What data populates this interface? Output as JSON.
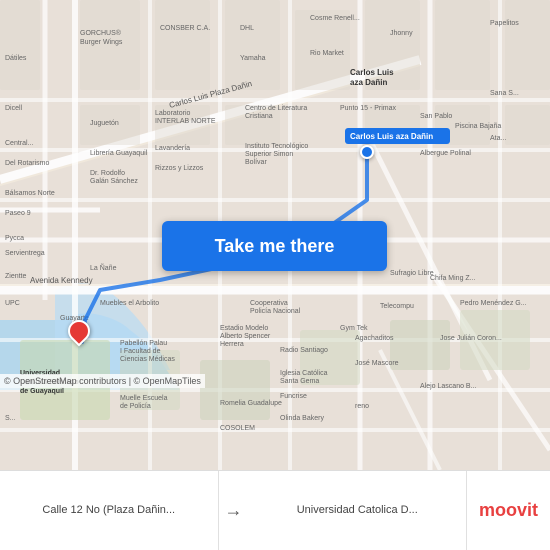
{
  "map": {
    "background_color": "#e8e0d8",
    "attribution": "© OpenStreetMap contributors | © OpenMapTiles"
  },
  "button": {
    "label": "Take me there"
  },
  "bottom_bar": {
    "from_label": "Calle 12 No (Plaza Dañin...",
    "to_label": "Universidad Catolica D...",
    "arrow": "→",
    "logo": "moovit"
  }
}
